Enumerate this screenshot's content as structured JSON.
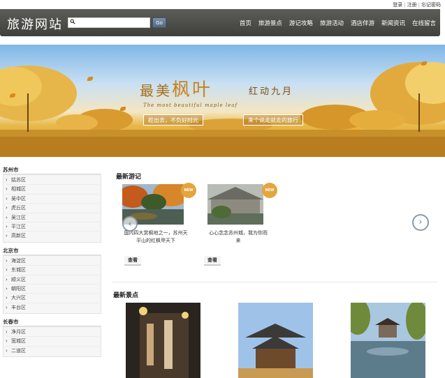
{
  "top_links": {
    "login": "登录",
    "register": "注册",
    "forgot": "忘记密码"
  },
  "header": {
    "logo": "旅游网站",
    "search": {
      "value": "",
      "placeholder": "",
      "button": "Go"
    },
    "nav": [
      "首页",
      "旅游景点",
      "游记攻略",
      "旅游活动",
      "酒店伴游",
      "新闻资讯",
      "在线留言"
    ]
  },
  "banner": {
    "title_a": "最美",
    "title_b": "枫叶",
    "subtitle": "红动九月",
    "english": "The most beautiful maple leaf",
    "tag1": "趁出去，不负好时光",
    "tag2": "来个说走就走的旅行"
  },
  "sidebar": {
    "groups": [
      {
        "title": "苏州市",
        "items": [
          "姑苏区",
          "相城区",
          "吴中区",
          "虎丘区",
          "吴江区",
          "平江区",
          "高新区"
        ]
      },
      {
        "title": "北京市",
        "items": [
          "海淀区",
          "东城区",
          "顺义区",
          "朝阳区",
          "大兴区",
          "丰台区"
        ]
      },
      {
        "title": "长春市",
        "items": [
          "净月区",
          "宽城区",
          "二道区"
        ]
      }
    ]
  },
  "latest_notes": {
    "title": "最新游记",
    "badge": "NEW",
    "cards": [
      {
        "text": "国内四大赏枫地之一，苏州天平山的红枫甲天下",
        "button": "查看"
      },
      {
        "text": "心心念念苏州城，我为你而来",
        "button": "查看"
      }
    ]
  },
  "latest_spots": {
    "title": "最新景点"
  },
  "icons": {
    "search": "search-icon",
    "prev": "chevron-left-icon",
    "next": "chevron-right-icon"
  },
  "colors": {
    "header": "#4b4b48",
    "accent": "#e4a53c"
  }
}
